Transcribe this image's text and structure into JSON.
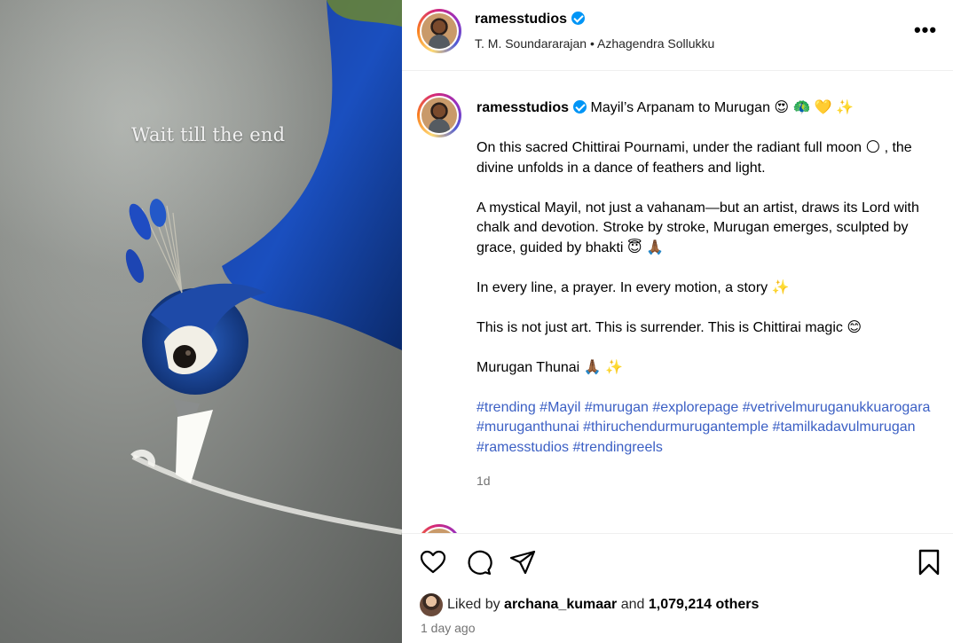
{
  "post": {
    "overlay_text": "Wait till the end",
    "author": {
      "username": "ramesstudios",
      "verified": true
    },
    "audio": {
      "text": "T. M. Soundararajan • Azhagendra Sollukku"
    },
    "caption": {
      "username": "ramesstudios",
      "title": "Mayil’s Arpanam to Murugan 😍 🦚 💛 ✨",
      "paragraphs": [
        "On this sacred Chittirai Pournami, under the radiant full moon 🌕 , the divine unfolds in a dance of feathers and light.",
        "A mystical Mayil, not just a vahanam—but an artist, draws its Lord with chalk and devotion. Stroke by stroke, Murugan emerges, sculpted by grace, guided by bhakti 😇 🙏🏾",
        "In every line, a prayer. In every motion, a story ✨",
        "This is not just art. This is surrender. This is Chittirai magic 😊",
        "Murugan Thunai 🙏🏾 ✨"
      ],
      "hashtags": "#trending #Mayil #murugan #explorepage #vetrivelmuruganukkuarogara #muruganthunai #thiruchendurmurugantemple #tamilkadavulmurugan #ramesstudios #trendingreels",
      "relative_time": "1d"
    },
    "likes": {
      "prefix": "Liked by",
      "liker": "archana_kumaar",
      "and": "and",
      "others": "1,079,214 others"
    },
    "date": "1 day ago"
  },
  "icons": {
    "like": "heart-icon",
    "comment": "comment-icon",
    "share": "share-icon",
    "save": "bookmark-icon",
    "more": "more-icon",
    "verified": "verified-icon"
  },
  "colors": {
    "hashtag": "#3b5fc4",
    "verified": "#0095f6",
    "muted": "#737373"
  }
}
